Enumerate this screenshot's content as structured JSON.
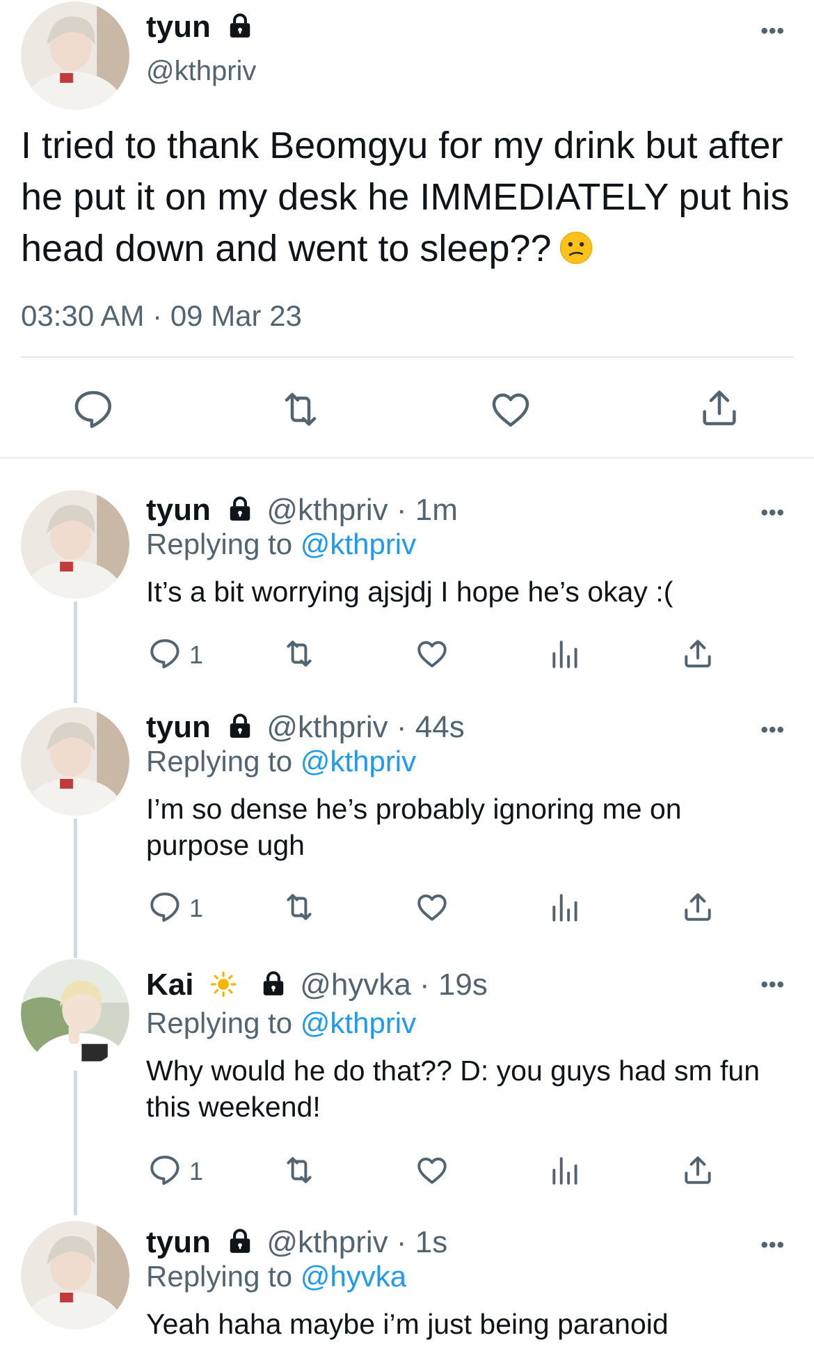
{
  "colors": {
    "text": "#0f1419",
    "secondary": "#536471",
    "link": "#1d9bf0",
    "thread_line": "#cfd9de"
  },
  "main_tweet": {
    "display_name": "tyun",
    "handle": "@kthpriv",
    "text": "I tried to thank Beomgyu for my drink but after he put it on my desk he IMMEDIATELY put his head down and went to sleep??",
    "emoji": "confused-face",
    "time": "03:30 AM",
    "separator": "·",
    "date": "09 Mar 23",
    "more_label": "•••"
  },
  "icons": {
    "reply": "reply-icon",
    "retweet": "retweet-icon",
    "like": "heart-icon",
    "share": "share-icon",
    "views": "views-icon",
    "lock": "lock-icon"
  },
  "replying_label": "Replying to",
  "replies": [
    {
      "display_name": "tyun",
      "handle": "@kthpriv",
      "time_sep": "·",
      "time": "1m",
      "replying_to": "@kthpriv",
      "text": "It’s a bit worrying ajsjdj I hope he’s okay :(",
      "reply_count": "1"
    },
    {
      "display_name": "tyun",
      "handle": "@kthpriv",
      "time_sep": "·",
      "time": "44s",
      "replying_to": "@kthpriv",
      "text": "I’m so dense he’s probably ignoring me on purpose ugh",
      "reply_count": "1"
    },
    {
      "display_name": "Kai",
      "name_emoji": "sun-icon",
      "handle": "@hyvka",
      "time_sep": "·",
      "time": "19s",
      "replying_to": "@kthpriv",
      "text": "Why would he do that?? D: you guys had sm fun this weekend!",
      "reply_count": "1"
    },
    {
      "display_name": "tyun",
      "handle": "@kthpriv",
      "time_sep": "·",
      "time": "1s",
      "replying_to": "@hyvka",
      "text": "Yeah haha maybe i’m just being paranoid"
    }
  ]
}
